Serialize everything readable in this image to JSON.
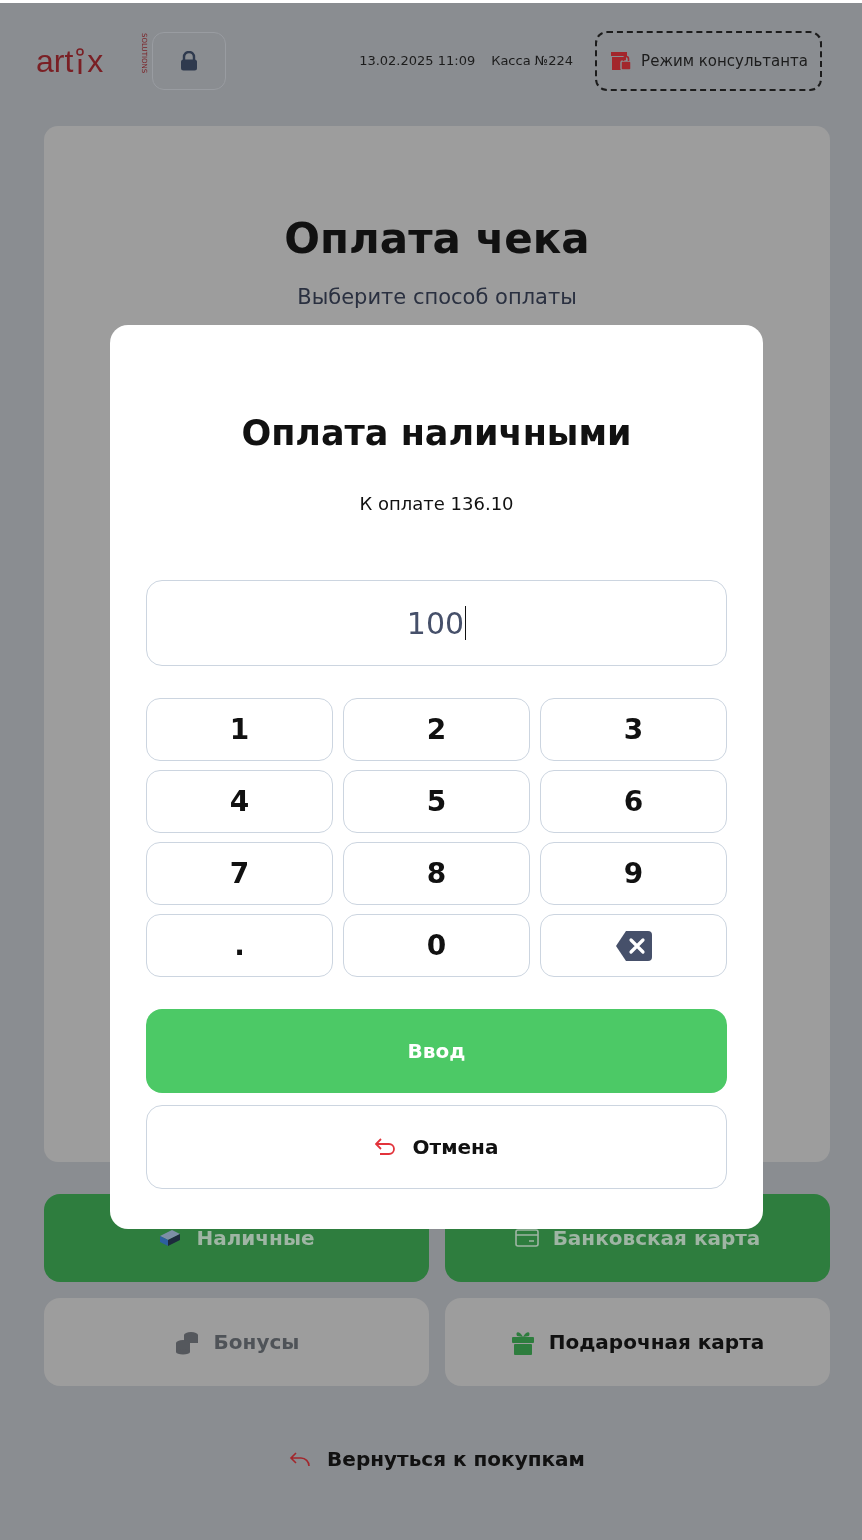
{
  "header": {
    "logo": {
      "left": "art",
      "right": "x",
      "tagline": "SOLUTIONS"
    },
    "datetime": "13.02.2025 11:09",
    "register": "Касса №224",
    "consultant_mode": "Режим консультанта"
  },
  "page": {
    "title": "Оплата чека",
    "subtitle": "Выберите способ оплаты"
  },
  "payment_methods": [
    {
      "label": "Наличные",
      "kind": "primary",
      "disabled": true
    },
    {
      "label": "Банковская карта",
      "kind": "primary",
      "disabled": true
    },
    {
      "label": "Бонусы",
      "kind": "secondary",
      "disabled": true
    },
    {
      "label": "Подарочная карта",
      "kind": "secondary",
      "disabled": false
    }
  ],
  "back_link": "Вернуться к покупкам",
  "modal": {
    "title": "Оплата наличными",
    "amount_due": "К оплате 136.10",
    "value": "100",
    "keys": [
      {
        "kind": "digit",
        "label": "1"
      },
      {
        "kind": "digit",
        "label": "2"
      },
      {
        "kind": "digit",
        "label": "3"
      },
      {
        "kind": "digit",
        "label": "4"
      },
      {
        "kind": "digit",
        "label": "5"
      },
      {
        "kind": "digit",
        "label": "6"
      },
      {
        "kind": "digit",
        "label": "7"
      },
      {
        "kind": "digit",
        "label": "8"
      },
      {
        "kind": "digit",
        "label": "9"
      },
      {
        "kind": "digit",
        "label": "."
      },
      {
        "kind": "digit",
        "label": "0"
      },
      {
        "kind": "backspace"
      }
    ],
    "confirm": "Ввод",
    "cancel": "Отмена"
  }
}
